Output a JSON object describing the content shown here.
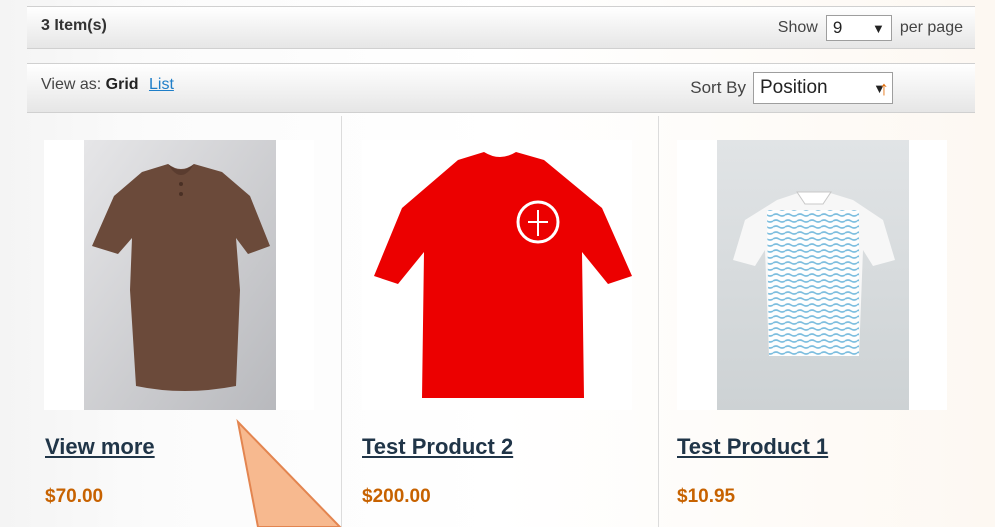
{
  "toolbar": {
    "item_count": "3 Item(s)",
    "show_label": "Show",
    "per_page_value": "9",
    "per_page_suffix": "per page",
    "view_as_label": "View as:",
    "view_grid": "Grid",
    "view_list": "List",
    "sort_by_label": "Sort By",
    "sort_value": "Position",
    "sort_direction_icon": "arrow-up-icon"
  },
  "products": [
    {
      "name": "View more",
      "price": "$70.00",
      "image": "brown-tshirt"
    },
    {
      "name": "Test Product 2",
      "price": "$200.00",
      "image": "red-tshirt"
    },
    {
      "name": "Test Product 1",
      "price": "$10.95",
      "image": "white-striped-polo"
    }
  ],
  "colors": {
    "price": "#c76200",
    "link": "#1e7ec8",
    "sort_arrow": "#e36d0a",
    "callout_fill": "#f7b98f",
    "callout_stroke": "#e38550"
  }
}
